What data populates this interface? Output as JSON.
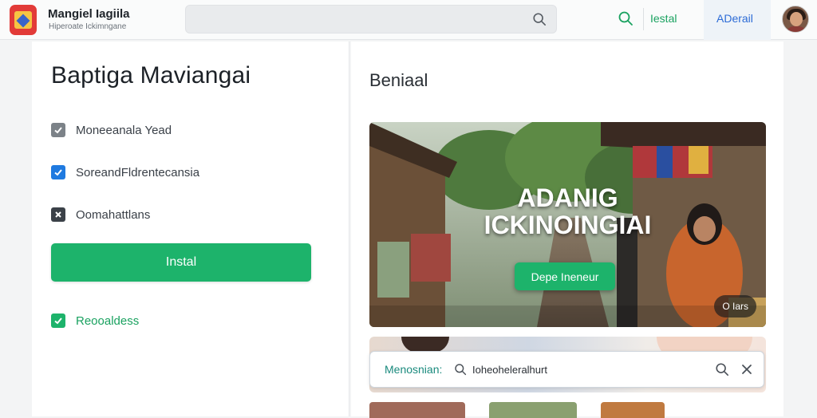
{
  "app": {
    "title": "Mangiel Iagiila",
    "subtitle": "Hiperoate Ickimngane"
  },
  "search": {
    "placeholder": ""
  },
  "nav": {
    "install": "Iestal",
    "advanced": "ADerail"
  },
  "left": {
    "title": "Baptiga Maviangai",
    "options": [
      {
        "label": "Moneeanala Yead",
        "state": "checked-gray"
      },
      {
        "label": "SoreandFldrentecansia",
        "state": "checked-blue"
      },
      {
        "label": "Oomahattlans",
        "state": "x-dark"
      }
    ],
    "install_button": "Instal",
    "footer_option": {
      "label": "Reooaldess",
      "state": "checked-green"
    }
  },
  "right": {
    "section_title": "Beniaal",
    "hero": {
      "heading_line1": "ADANIG",
      "heading_line2": "ICKINOINGIAI",
      "cta": "Depe Ineneur",
      "badge": "O Iars"
    },
    "mention": {
      "label": "Menosnian:",
      "value": "Ioheoheleralhurt"
    }
  },
  "colors": {
    "accent_green": "#1db36b",
    "accent_blue": "#2c6bd6",
    "teal": "#1a8a7d"
  },
  "icons": [
    "app-logo-icon",
    "search-icon",
    "check-icon",
    "x-icon",
    "close-icon",
    "avatar"
  ]
}
